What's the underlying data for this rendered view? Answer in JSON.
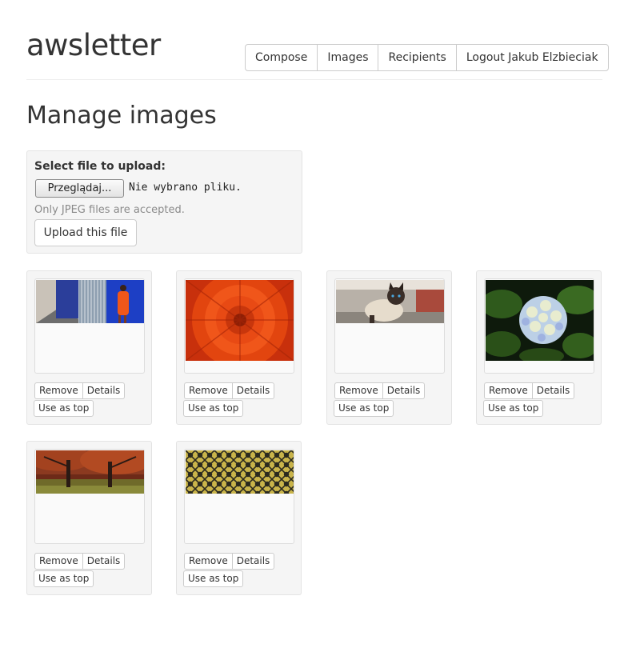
{
  "app": {
    "brand": "awsletter"
  },
  "nav": {
    "items": [
      {
        "label": "Compose"
      },
      {
        "label": "Images"
      },
      {
        "label": "Recipients"
      },
      {
        "label": "Logout Jakub Elzbieciak"
      }
    ]
  },
  "page": {
    "title": "Manage images"
  },
  "upload": {
    "label": "Select file to upload:",
    "browse_label": "Przeglądaj...",
    "file_status": "Nie wybrano pliku.",
    "help": "Only JPEG files are accepted.",
    "submit_label": "Upload this file"
  },
  "card_buttons": {
    "remove": "Remove",
    "details": "Details",
    "use_as_top": "Use as top"
  },
  "images": [
    {
      "subject": "street-wall-orange-dress"
    },
    {
      "subject": "orange-chrysanthemum"
    },
    {
      "subject": "siamese-cat"
    },
    {
      "subject": "hydrangea-flower"
    },
    {
      "subject": "autumn-trees"
    },
    {
      "subject": "gold-pattern"
    }
  ],
  "colors": {
    "panel_bg": "#f5f5f5",
    "border": "#cccccc",
    "text": "#333333",
    "muted": "#8a8a8a"
  }
}
